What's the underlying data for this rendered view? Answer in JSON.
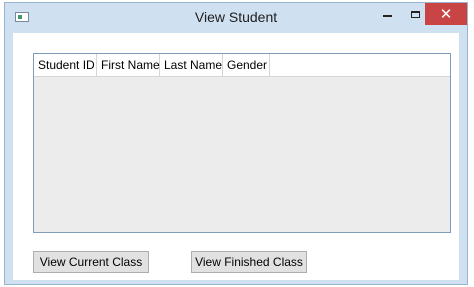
{
  "window": {
    "title": "View Student"
  },
  "titlebar": {
    "minimize_glyph": "",
    "maximize_glyph": "",
    "close_glyph": "✕"
  },
  "grid": {
    "columns": [
      "Student ID",
      "First Name",
      "Last Name",
      "Gender"
    ],
    "rows": []
  },
  "buttons": {
    "current_class": "View Current Class",
    "finished_class": "View Finished Class"
  },
  "colors": {
    "titlebar_bg": "#cfe0f1",
    "close_button_bg": "#c94545",
    "grid_bg": "#ececec",
    "button_bg": "#e1e1e1"
  }
}
